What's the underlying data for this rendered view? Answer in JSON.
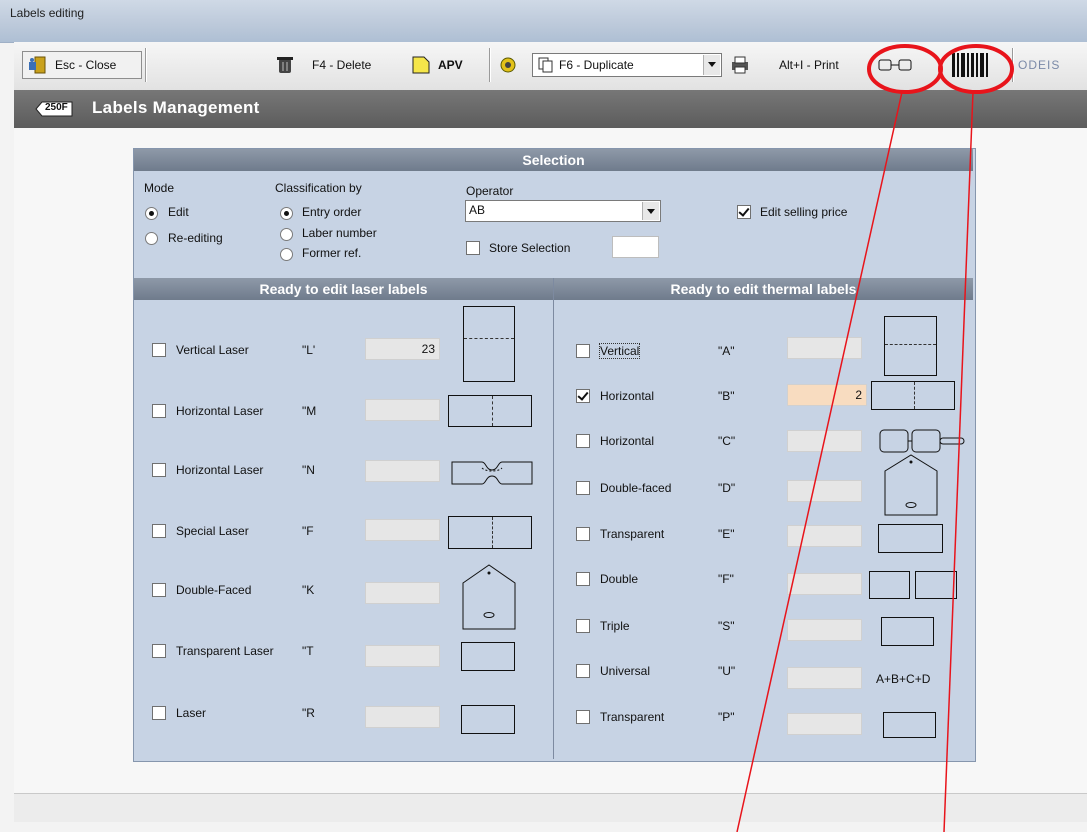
{
  "window": {
    "title": "Labels editing"
  },
  "toolbar": {
    "close_label": "Esc - Close",
    "delete_label": "F4 - Delete",
    "apv_label": "APV",
    "duplicate_value": "F6 - Duplicate",
    "print_label": "Alt+I - Print",
    "logo_text": "ODEIS"
  },
  "header": {
    "badge": "250F",
    "title": "Labels Management"
  },
  "selection": {
    "title": "Selection",
    "mode_label": "Mode",
    "mode_options": [
      "Edit",
      "Re-editing"
    ],
    "mode_selected": 0,
    "class_label": "Classification by",
    "class_options": [
      "Entry order",
      "Laber number",
      "Former ref."
    ],
    "class_selected": 0,
    "operator_label": "Operator",
    "operator_value": "AB",
    "store_selection_label": "Store Selection",
    "edit_price_label": "Edit selling price",
    "edit_price_checked": true
  },
  "laser": {
    "title": "Ready to edit laser labels",
    "rows": [
      {
        "label": "Vertical Laser",
        "code": "\"L'",
        "qty": "23",
        "shape": "vertical"
      },
      {
        "label": "Horizontal Laser",
        "code": "\"M",
        "qty": "",
        "shape": "horizontal"
      },
      {
        "label": "Horizontal Laser",
        "code": "\"N",
        "qty": "",
        "shape": "jewel"
      },
      {
        "label": "Special Laser",
        "code": "\"F",
        "qty": "",
        "shape": "horizontal"
      },
      {
        "label": "Double-Faced",
        "code": "\"K",
        "qty": "",
        "shape": "tag"
      },
      {
        "label": "Transparent Laser",
        "code": "\"T",
        "qty": "",
        "shape": "rect"
      },
      {
        "label": "Laser",
        "code": "\"R",
        "qty": "",
        "shape": "rect"
      }
    ]
  },
  "thermal": {
    "title": "Ready to edit thermal labels",
    "rows": [
      {
        "label": "Vertical",
        "code": "\"A\"",
        "qty": "",
        "checked": false
      },
      {
        "label": "Horizontal",
        "code": "\"B\"",
        "qty": "2",
        "checked": true
      },
      {
        "label": "Horizontal",
        "code": "\"C\"",
        "qty": "",
        "checked": false
      },
      {
        "label": "Double-faced",
        "code": "\"D\"",
        "qty": "",
        "checked": false
      },
      {
        "label": "Transparent",
        "code": "\"E\"",
        "qty": "",
        "checked": false
      },
      {
        "label": "Double",
        "code": "\"F\"",
        "qty": "",
        "checked": false
      },
      {
        "label": "Triple",
        "code": "\"S\"",
        "qty": "",
        "checked": false
      },
      {
        "label": "Universal",
        "code": "\"U\"",
        "qty": "",
        "checked": false
      },
      {
        "label": "Transparent",
        "code": "\"P\"",
        "qty": "",
        "checked": false
      }
    ],
    "universal_text": "A+B+C+D"
  },
  "colors": {
    "panel": "#c7d3e4",
    "band": "#7b8696",
    "annotation": "#e8141b",
    "peach": "#f8dcc0"
  }
}
